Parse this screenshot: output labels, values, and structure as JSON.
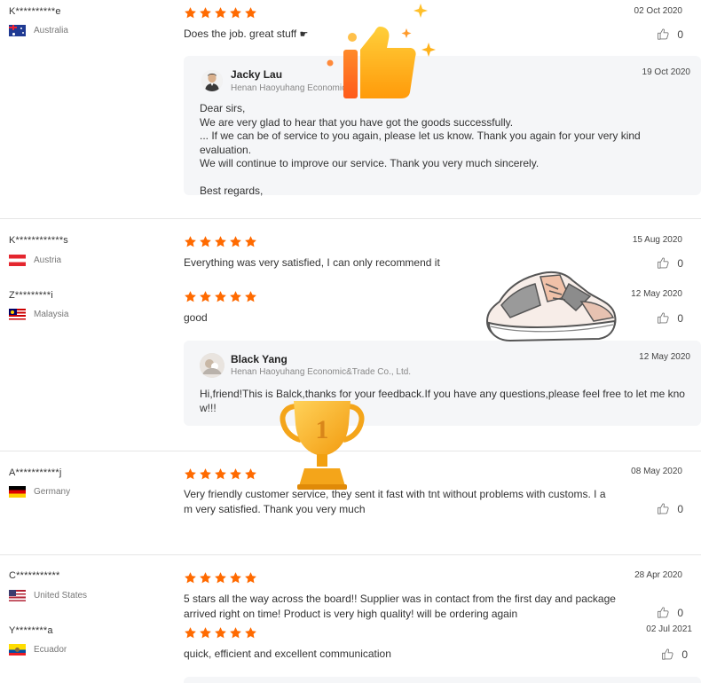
{
  "reviews": [
    {
      "user": "K**********e",
      "country": "Australia",
      "flag": "australia-flag",
      "rating": 5,
      "date": "02 Oct 2020",
      "comment": "Does the job. great stuff",
      "comment_icon": "pointing-hand-icon",
      "likes": "0",
      "reply": {
        "name": "Jacky Lau",
        "company": "Henan Haoyuhang Economic",
        "date": "19 Oct 2020",
        "text": "Dear sirs,\nWe are very glad to hear that you have got the goods successfully.\n... If we can be of service to you again, please let us know. Thank you again for your very kind evaluation.\nWe will continue to improve our service. Thank you very much sincerely.\n\nBest regards,"
      }
    },
    {
      "user": "K************s",
      "country": "Austria",
      "flag": "austria-flag",
      "rating": 5,
      "date": "15 Aug 2020",
      "comment": "Everything was very satisfied, I can only recommend it",
      "likes": "0"
    },
    {
      "user": "Z*********i",
      "country": "Malaysia",
      "flag": "malaysia-flag",
      "rating": 5,
      "date": "12 May 2020",
      "comment": "good",
      "likes": "0",
      "reply": {
        "name": "Black Yang",
        "company": "Henan Haoyuhang Economic&Trade Co., Ltd.",
        "date": "12 May 2020",
        "text": "Hi,friend!This is Balck,thanks for your feedback.If you have any questions,please feel free to let me kno\nw!!!"
      }
    },
    {
      "user": "A***********j",
      "country": "Germany",
      "flag": "germany-flag",
      "rating": 5,
      "date": "08 May 2020",
      "comment": "Very friendly customer service, they sent it fast with tnt without problems with customs. I a\nm very satisfied. Thank you very much",
      "likes": "0"
    },
    {
      "user": "C***********",
      "country": "United States",
      "flag": "usa-flag",
      "rating": 5,
      "date": "28 Apr 2020",
      "comment": "5 stars all the way across the board!! Supplier was in contact from the first day and package\narrived right on time! Product is very high quality! will be ordering again",
      "likes": "0"
    },
    {
      "user": "Y********a",
      "country": "Ecuador",
      "flag": "ecuador-flag",
      "rating": 5,
      "date": "02 Jul 2021",
      "comment": "quick, efficient and excellent communication",
      "likes": "0"
    }
  ],
  "colors": {
    "star": "#ff6a00",
    "reply_bg": "#f5f6f8",
    "divider": "#e6e6e6"
  },
  "stickers": {
    "thumbs_up": "thumbs-up-sticker-icon",
    "trophy": "trophy-sticker-icon",
    "trophy_number": "1",
    "sneaker": "sneaker-sticker-icon"
  }
}
